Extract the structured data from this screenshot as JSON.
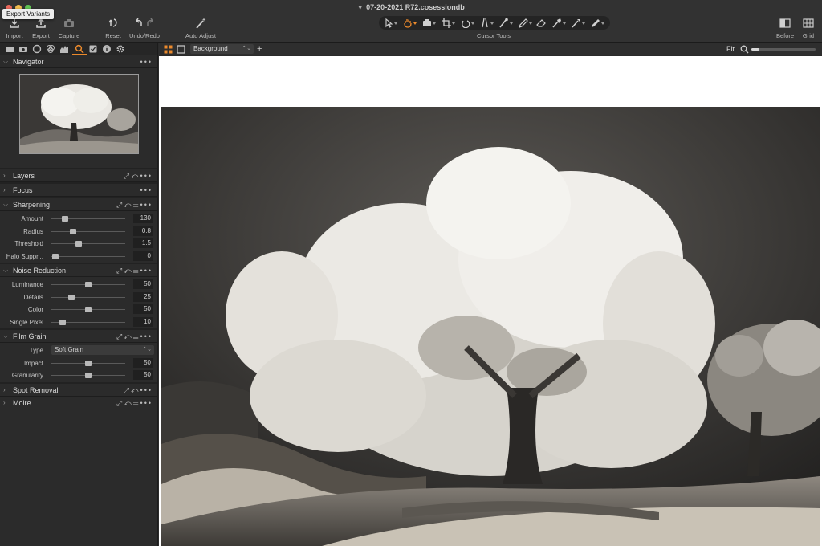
{
  "window": {
    "title": "07-20-2021 R72.cosessiondb",
    "tooltip": "Export Variants"
  },
  "toolbar": {
    "import": "Import",
    "export": "Export",
    "capture": "Capture",
    "reset": "Reset",
    "undo_redo": "Undo/Redo",
    "auto_adjust": "Auto Adjust",
    "cursor_tools": "Cursor Tools",
    "before": "Before",
    "grid": "Grid"
  },
  "tools": {
    "navigator": "Navigator",
    "layers": "Layers",
    "focus": "Focus",
    "sharpening": {
      "title": "Sharpening",
      "rows": [
        {
          "label": "Amount",
          "value": "130",
          "pos": 0.18
        },
        {
          "label": "Radius",
          "value": "0.8",
          "pos": 0.29
        },
        {
          "label": "Threshold",
          "value": "1.5",
          "pos": 0.37
        },
        {
          "label": "Halo Suppr...",
          "value": "0",
          "pos": 0.05
        }
      ]
    },
    "noise_reduction": {
      "title": "Noise Reduction",
      "rows": [
        {
          "label": "Luminance",
          "value": "50",
          "pos": 0.5
        },
        {
          "label": "Details",
          "value": "25",
          "pos": 0.27
        },
        {
          "label": "Color",
          "value": "50",
          "pos": 0.5
        },
        {
          "label": "Single Pixel",
          "value": "10",
          "pos": 0.15
        }
      ]
    },
    "film_grain": {
      "title": "Film Grain",
      "type_label": "Type",
      "type_value": "Soft Grain",
      "rows": [
        {
          "label": "Impact",
          "value": "50",
          "pos": 0.5
        },
        {
          "label": "Granularity",
          "value": "50",
          "pos": 0.5
        }
      ]
    },
    "spot_removal": "Spot Removal",
    "moire": "Moire"
  },
  "viewer": {
    "layer": "Background",
    "fit": "Fit",
    "zoom_level": 0.12
  },
  "colors": {
    "accent": "#ec8a2c",
    "panel": "#2b2b2b",
    "toolbar": "#323232"
  }
}
